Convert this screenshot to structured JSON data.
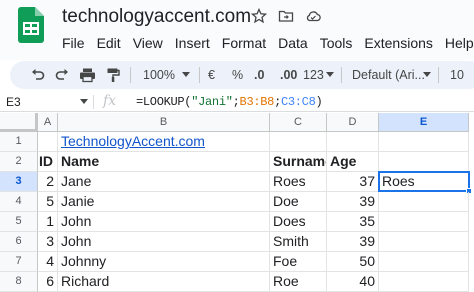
{
  "app": {
    "doc_title": "technologyaccent.com",
    "menu": [
      "File",
      "Edit",
      "View",
      "Insert",
      "Format",
      "Data",
      "Tools",
      "Extensions",
      "Help"
    ]
  },
  "toolbar": {
    "zoom": "100%",
    "currency": "€",
    "percent": "%",
    "decrease_decimals": ".0",
    "increase_decimals": ".00",
    "more_formats": "123",
    "font": "Default (Ari...",
    "font_size": "10"
  },
  "formula_bar": {
    "name_box": "E3",
    "fx": "fx",
    "formula_prefix": "=LOOKUP(",
    "formula_string": "\"Jani\"",
    "formula_sep1": ";",
    "formula_range1": "B3:B8",
    "formula_sep2": ";",
    "formula_range2": "C3:C8",
    "formula_suffix": ")"
  },
  "grid": {
    "columns": [
      "A",
      "B",
      "C",
      "D",
      "E"
    ],
    "row_numbers": [
      "1",
      "2",
      "3",
      "4",
      "5",
      "6",
      "7",
      "8"
    ],
    "rows": [
      {
        "a": "",
        "b": "TechnologyAccent.com",
        "c": "",
        "d": "",
        "e": ""
      },
      {
        "a": "ID",
        "b": "Name",
        "c": "Surname",
        "d": "Age",
        "e": ""
      },
      {
        "a": "2",
        "b": "Jane",
        "c": "Roes",
        "d": "37",
        "e": "Roes"
      },
      {
        "a": "5",
        "b": "Janie",
        "c": "Doe",
        "d": "39",
        "e": ""
      },
      {
        "a": "1",
        "b": "John",
        "c": "Does",
        "d": "35",
        "e": ""
      },
      {
        "a": "3",
        "b": "John",
        "c": "Smith",
        "d": "39",
        "e": ""
      },
      {
        "a": "4",
        "b": "Johnny",
        "c": "Foe",
        "d": "50",
        "e": ""
      },
      {
        "a": "6",
        "b": "Richard",
        "c": "Roe",
        "d": "40",
        "e": ""
      }
    ],
    "selected_cell": "E3"
  },
  "colors": {
    "accent": "#1a73e8",
    "link": "#1155cc",
    "formula_string": "#137333",
    "range1": "#e37400",
    "range2": "#3d82f7"
  }
}
